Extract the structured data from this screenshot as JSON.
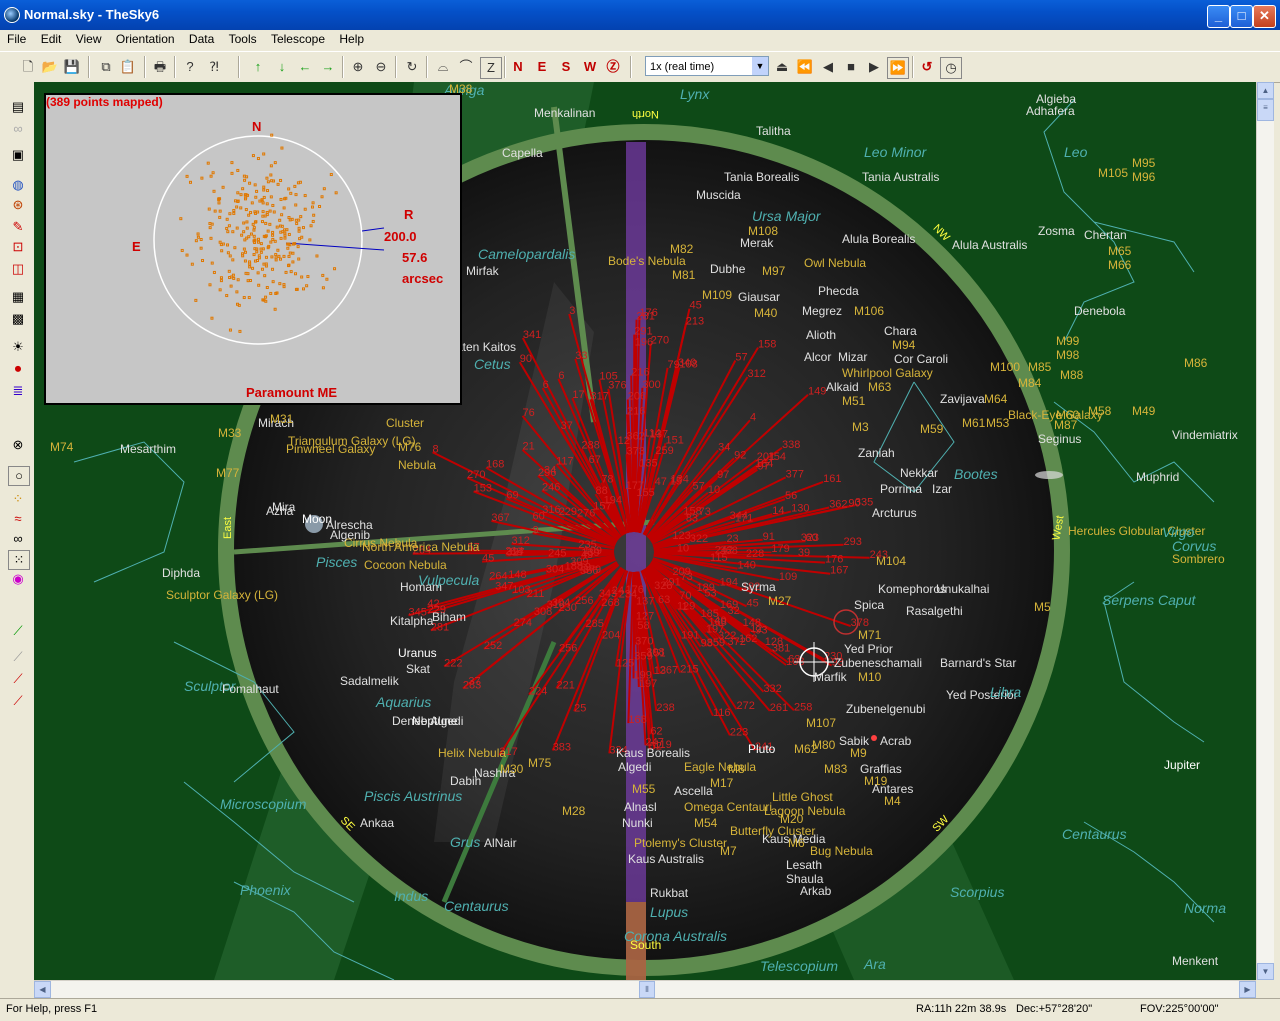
{
  "window": {
    "title": "Normal.sky - TheSky6"
  },
  "menu": [
    "File",
    "Edit",
    "View",
    "Orientation",
    "Data",
    "Tools",
    "Telescope",
    "Help"
  ],
  "toolbar": {
    "time_speed": "1x (real time)"
  },
  "status": {
    "help": "For Help, press F1",
    "ra": "RA:11h 22m 38.9s",
    "dec": "Dec:+57°28'20\"",
    "fov": "FOV:225°00'00\""
  },
  "inset": {
    "points": "389 points mapped",
    "n": "N",
    "e": "E",
    "r": "R",
    "rms": "200.0",
    "pe": "57.6",
    "unit": "arcsec",
    "mount": "Paramount ME"
  },
  "directions": {
    "north": "North",
    "south": "South",
    "east": "East",
    "west": "West",
    "nw": "NW",
    "se": "SE",
    "sw": "SW"
  },
  "colors": {
    "sky": "#0e4a17",
    "horizon": "#5e8b4e",
    "mapping_lines": "#c00000",
    "constellation": "#4fb0b0",
    "star_label": "#e0e0e0",
    "dso_label": "#d6b43a",
    "milky_way": "#2f7a3a"
  },
  "labels": [
    {
      "t": "Auriga",
      "c": "con"
    },
    {
      "t": "Lynx",
      "c": "con"
    },
    {
      "t": "Menkalinan",
      "c": "star"
    },
    {
      "t": "M38",
      "c": "dso"
    },
    {
      "t": "Capella",
      "c": "star"
    },
    {
      "t": "Talitha",
      "c": "star"
    },
    {
      "t": "Tania Borealis",
      "c": "star"
    },
    {
      "t": "Tania Australis",
      "c": "star"
    },
    {
      "t": "Leo Minor",
      "c": "con"
    },
    {
      "t": "Leo",
      "c": "con"
    },
    {
      "t": "Algieba",
      "c": "star"
    },
    {
      "t": "Adhafera",
      "c": "star"
    },
    {
      "t": "M95",
      "c": "dso"
    },
    {
      "t": "M96",
      "c": "dso"
    },
    {
      "t": "M105",
      "c": "dso"
    },
    {
      "t": "Zosma",
      "c": "star"
    },
    {
      "t": "Chertan",
      "c": "star"
    },
    {
      "t": "M65",
      "c": "dso"
    },
    {
      "t": "M66",
      "c": "dso"
    },
    {
      "t": "Muscida",
      "c": "star"
    },
    {
      "t": "Ursa Major",
      "c": "con"
    },
    {
      "t": "M108",
      "c": "dso"
    },
    {
      "t": "Merak",
      "c": "star"
    },
    {
      "t": "Alula Borealis",
      "c": "star"
    },
    {
      "t": "Alula Australis",
      "c": "star"
    },
    {
      "t": "M82",
      "c": "dso"
    },
    {
      "t": "Bode's Nebula",
      "c": "dso"
    },
    {
      "t": "M81",
      "c": "dso"
    },
    {
      "t": "Dubhe",
      "c": "star"
    },
    {
      "t": "M97",
      "c": "dso"
    },
    {
      "t": "Owl Nebula",
      "c": "dso"
    },
    {
      "t": "Camelopardalis",
      "c": "con"
    },
    {
      "t": "Mirfak",
      "c": "star"
    },
    {
      "t": "M109",
      "c": "dso"
    },
    {
      "t": "Giausar",
      "c": "star"
    },
    {
      "t": "Phecda",
      "c": "star"
    },
    {
      "t": "Megrez",
      "c": "star"
    },
    {
      "t": "M106",
      "c": "dso"
    },
    {
      "t": "M40",
      "c": "dso"
    },
    {
      "t": "Denebola",
      "c": "star"
    },
    {
      "t": "Chara",
      "c": "star"
    },
    {
      "t": "Alioth",
      "c": "star"
    },
    {
      "t": "M94",
      "c": "dso"
    },
    {
      "t": "Cor Caroli",
      "c": "star"
    },
    {
      "t": "Alcor",
      "c": "star"
    },
    {
      "t": "Mizar",
      "c": "star"
    },
    {
      "t": "Whirlpool Galaxy",
      "c": "dso"
    },
    {
      "t": "Alkaid",
      "c": "star"
    },
    {
      "t": "M63",
      "c": "dso"
    },
    {
      "t": "M51",
      "c": "dso"
    },
    {
      "t": "M99",
      "c": "dso"
    },
    {
      "t": "M98",
      "c": "dso"
    },
    {
      "t": "M100",
      "c": "dso"
    },
    {
      "t": "M85",
      "c": "dso"
    },
    {
      "t": "M88",
      "c": "dso"
    },
    {
      "t": "M84",
      "c": "dso"
    },
    {
      "t": "M86",
      "c": "dso"
    },
    {
      "t": "Zavijava",
      "c": "star"
    },
    {
      "t": "M64",
      "c": "dso"
    },
    {
      "t": "Black-Eye Galaxy",
      "c": "dso"
    },
    {
      "t": "M60",
      "c": "dso"
    },
    {
      "t": "M58",
      "c": "dso"
    },
    {
      "t": "M49",
      "c": "dso"
    },
    {
      "t": "M61",
      "c": "dso"
    },
    {
      "t": "M53",
      "c": "dso"
    },
    {
      "t": "M87",
      "c": "dso"
    },
    {
      "t": "M59",
      "c": "dso"
    },
    {
      "t": "M3",
      "c": "dso"
    },
    {
      "t": "Seginus",
      "c": "star"
    },
    {
      "t": "Vindemiatrix",
      "c": "star"
    },
    {
      "t": "Zaniah",
      "c": "star"
    },
    {
      "t": "Nekkar",
      "c": "star"
    },
    {
      "t": "Bootes",
      "c": "con"
    },
    {
      "t": "Muphrid",
      "c": "star"
    },
    {
      "t": "Porrima",
      "c": "star"
    },
    {
      "t": "Izar",
      "c": "star"
    },
    {
      "t": "Arcturus",
      "c": "star"
    },
    {
      "t": "Hercules Globular Cluster",
      "c": "dso"
    },
    {
      "t": "Virgo",
      "c": "con"
    },
    {
      "t": "Corvus",
      "c": "con"
    },
    {
      "t": "Sombrero",
      "c": "dso"
    },
    {
      "t": "M104",
      "c": "dso"
    },
    {
      "t": "Komephoros",
      "c": "star"
    },
    {
      "t": "Unukalhai",
      "c": "star"
    },
    {
      "t": "Serpens Caput",
      "c": "con"
    },
    {
      "t": "Spica",
      "c": "star"
    },
    {
      "t": "Rasalgethi",
      "c": "star"
    },
    {
      "t": "M5",
      "c": "dso"
    },
    {
      "t": "Syrma",
      "c": "star"
    },
    {
      "t": "M27",
      "c": "dso"
    },
    {
      "t": "M71",
      "c": "dso"
    },
    {
      "t": "Yed Prior",
      "c": "star"
    },
    {
      "t": "Barnard's Star",
      "c": "star"
    },
    {
      "t": "Zubeneschamali",
      "c": "star"
    },
    {
      "t": "Marfik",
      "c": "star"
    },
    {
      "t": "M10",
      "c": "dso"
    },
    {
      "t": "Yed Posterior",
      "c": "star"
    },
    {
      "t": "Libra",
      "c": "con"
    },
    {
      "t": "Zubenelgenubi",
      "c": "star"
    },
    {
      "t": "M107",
      "c": "dso"
    },
    {
      "t": "Sabik",
      "c": "star"
    },
    {
      "t": "Acrab",
      "c": "star"
    },
    {
      "t": "M80",
      "c": "dso"
    },
    {
      "t": "M9",
      "c": "dso"
    },
    {
      "t": "Graffias",
      "c": "star"
    },
    {
      "t": "Jupiter",
      "c": "planet"
    },
    {
      "t": "M83",
      "c": "dso"
    },
    {
      "t": "M19",
      "c": "dso"
    },
    {
      "t": "Antares",
      "c": "star"
    },
    {
      "t": "M4",
      "c": "dso"
    },
    {
      "t": "M62",
      "c": "dso"
    },
    {
      "t": "Pluto",
      "c": "planet"
    },
    {
      "t": "M8",
      "c": "dso"
    },
    {
      "t": "Eagle Nebula",
      "c": "dso"
    },
    {
      "t": "M17",
      "c": "dso"
    },
    {
      "t": "Little Ghost",
      "c": "dso"
    },
    {
      "t": "Lagoon Nebula",
      "c": "dso"
    },
    {
      "t": "M20",
      "c": "dso"
    },
    {
      "t": "Butterfly Cluster",
      "c": "dso"
    },
    {
      "t": "Kaus Media",
      "c": "star"
    },
    {
      "t": "M6",
      "c": "dso"
    },
    {
      "t": "Bug Nebula",
      "c": "dso"
    },
    {
      "t": "Ptolemy's Cluster",
      "c": "dso"
    },
    {
      "t": "M7",
      "c": "dso"
    },
    {
      "t": "Kaus Australis",
      "c": "star"
    },
    {
      "t": "Lesath",
      "c": "star"
    },
    {
      "t": "Shaula",
      "c": "star"
    },
    {
      "t": "Rukbat",
      "c": "star"
    },
    {
      "t": "Arkab",
      "c": "star"
    },
    {
      "t": "Scorpius",
      "c": "con"
    },
    {
      "t": "Lupus",
      "c": "con"
    },
    {
      "t": "Corona Australis",
      "c": "con"
    },
    {
      "t": "Telescopium",
      "c": "con"
    },
    {
      "t": "Ara",
      "c": "con"
    },
    {
      "t": "Norma",
      "c": "con"
    },
    {
      "t": "Centaurus",
      "c": "con"
    },
    {
      "t": "Menkent",
      "c": "star"
    },
    {
      "t": "Omega Centauri",
      "c": "dso"
    },
    {
      "t": "Alnasl",
      "c": "star"
    },
    {
      "t": "Ascella",
      "c": "star"
    },
    {
      "t": "Nunki",
      "c": "star"
    },
    {
      "t": "M54",
      "c": "dso"
    },
    {
      "t": "M28",
      "c": "dso"
    },
    {
      "t": "M55",
      "c": "dso"
    },
    {
      "t": "Kaus Borealis",
      "c": "star"
    },
    {
      "t": "Algedi",
      "c": "star"
    },
    {
      "t": "M75",
      "c": "dso"
    },
    {
      "t": "Dabih",
      "c": "star"
    },
    {
      "t": "Nashira",
      "c": "star"
    },
    {
      "t": "M30",
      "c": "dso"
    },
    {
      "t": "Helix Nebula",
      "c": "dso"
    },
    {
      "t": "Neptune",
      "c": "planet"
    },
    {
      "t": "Deneb Algedi",
      "c": "star"
    },
    {
      "t": "Skat",
      "c": "star"
    },
    {
      "t": "Sadalmelik",
      "c": "star"
    },
    {
      "t": "Aquarius",
      "c": "con"
    },
    {
      "t": "Uranus",
      "c": "planet"
    },
    {
      "t": "Kitalpha",
      "c": "star"
    },
    {
      "t": "Biham",
      "c": "star"
    },
    {
      "t": "Homam",
      "c": "star"
    },
    {
      "t": "Vulpecula",
      "c": "con"
    },
    {
      "t": "Cirrus Nebula",
      "c": "dso"
    },
    {
      "t": "Algenib",
      "c": "star"
    },
    {
      "t": "Moon",
      "c": "planet"
    },
    {
      "t": "North America Nebula",
      "c": "dso"
    },
    {
      "t": "Cocoon Nebula",
      "c": "dso"
    },
    {
      "t": "Pisces",
      "c": "con"
    },
    {
      "t": "Alrescha",
      "c": "star"
    },
    {
      "t": "Mira",
      "c": "star"
    },
    {
      "t": "Azha",
      "c": "star"
    },
    {
      "t": "M77",
      "c": "dso"
    },
    {
      "t": "Mesarthim",
      "c": "star"
    },
    {
      "t": "M74",
      "c": "dso"
    },
    {
      "t": "Triangulum Galaxy (LG)",
      "c": "dso"
    },
    {
      "t": "Pinwheel Galaxy",
      "c": "dso"
    },
    {
      "t": "M33",
      "c": "dso"
    },
    {
      "t": "Mirach",
      "c": "star"
    },
    {
      "t": "M31",
      "c": "dso"
    },
    {
      "t": "M76",
      "c": "dso"
    },
    {
      "t": "Cluster",
      "c": "dso"
    },
    {
      "t": "Nebula",
      "c": "dso"
    },
    {
      "t": "Baten Kaitos",
      "c": "star"
    },
    {
      "t": "Cetus",
      "c": "con"
    },
    {
      "t": "Diphda",
      "c": "star"
    },
    {
      "t": "Sculptor Galaxy (LG)",
      "c": "dso"
    },
    {
      "t": "Sculptor",
      "c": "con"
    },
    {
      "t": "Fomalhaut",
      "c": "star"
    },
    {
      "t": "Piscis Austrinus",
      "c": "con"
    },
    {
      "t": "Microscopium",
      "c": "con"
    },
    {
      "t": "Ankaa",
      "c": "star"
    },
    {
      "t": "Grus",
      "c": "con"
    },
    {
      "t": "AlNair",
      "c": "star"
    },
    {
      "t": "Phoenix",
      "c": "con"
    },
    {
      "t": "Indus",
      "c": "con"
    },
    {
      "t": "Centaurus",
      "c": "con"
    }
  ]
}
